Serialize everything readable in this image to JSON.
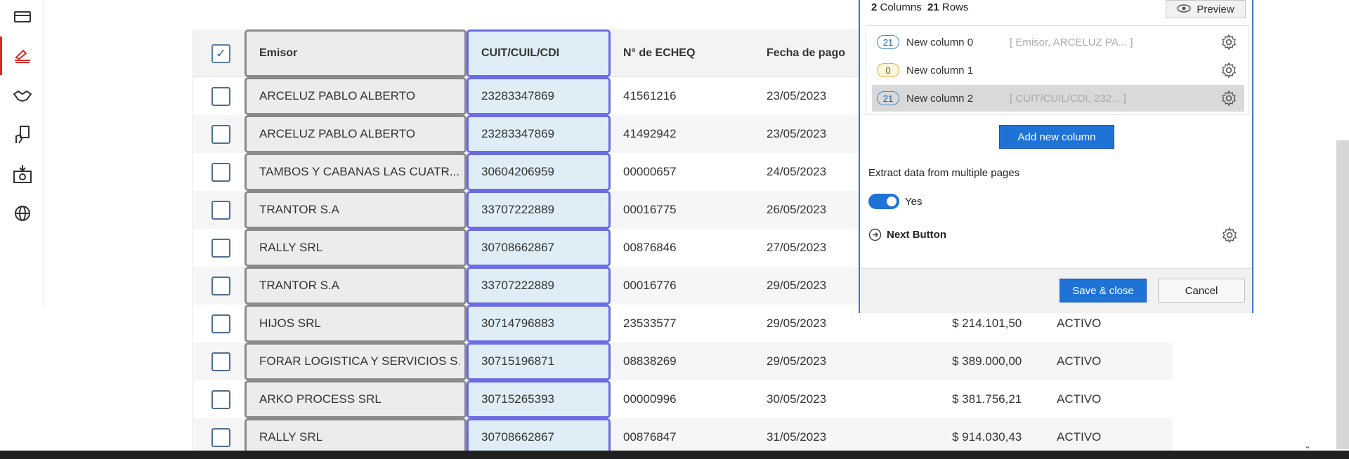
{
  "sidebar": {
    "items": [
      {
        "icon": "card-icon"
      },
      {
        "icon": "signature-icon",
        "active": true
      },
      {
        "icon": "handshake-icon"
      },
      {
        "icon": "hand-document-icon"
      },
      {
        "icon": "money-download-icon"
      },
      {
        "icon": "globe-icon"
      }
    ]
  },
  "table": {
    "headers": [
      "Emisor",
      "CUIT/CUIL/CDI",
      "N° de ECHEQ",
      "Fecha de pago"
    ],
    "rows": [
      {
        "emisor": "ARCELUZ PABLO ALBERTO",
        "cuit": "23283347869",
        "echeq": "41561216",
        "fecha": "23/05/2023",
        "monto": "",
        "estado": ""
      },
      {
        "emisor": "ARCELUZ PABLO ALBERTO",
        "cuit": "23283347869",
        "echeq": "41492942",
        "fecha": "23/05/2023",
        "monto": "",
        "estado": ""
      },
      {
        "emisor": "TAMBOS Y CABANAS LAS CUATR...",
        "cuit": "30604206959",
        "echeq": "00000657",
        "fecha": "24/05/2023",
        "monto": "",
        "estado": ""
      },
      {
        "emisor": "TRANTOR S.A",
        "cuit": "33707222889",
        "echeq": "00016775",
        "fecha": "26/05/2023",
        "monto": "",
        "estado": ""
      },
      {
        "emisor": "RALLY SRL",
        "cuit": "30708662867",
        "echeq": "00876846",
        "fecha": "27/05/2023",
        "monto": "",
        "estado": ""
      },
      {
        "emisor": "TRANTOR S.A",
        "cuit": "33707222889",
        "echeq": "00016776",
        "fecha": "29/05/2023",
        "monto": "",
        "estado": ""
      },
      {
        "emisor": "HIJOS SRL",
        "cuit": "30714796883",
        "echeq": "23533577",
        "fecha": "29/05/2023",
        "monto": "$ 214.101,50",
        "estado": "ACTIVO"
      },
      {
        "emisor": "FORAR LOGISTICA Y SERVICIOS S...",
        "cuit": "30715196871",
        "echeq": "08838269",
        "fecha": "29/05/2023",
        "monto": "$ 389.000,00",
        "estado": "ACTIVO"
      },
      {
        "emisor": "ARKO PROCESS SRL",
        "cuit": "30715265393",
        "echeq": "00000996",
        "fecha": "30/05/2023",
        "monto": "$ 381.756,21",
        "estado": "ACTIVO"
      },
      {
        "emisor": "RALLY SRL",
        "cuit": "30708662867",
        "echeq": "00876847",
        "fecha": "31/05/2023",
        "monto": "$ 914.030,43",
        "estado": "ACTIVO"
      }
    ]
  },
  "dialog": {
    "columns_count": "2",
    "columns_label": "Columns",
    "rows_count": "21",
    "rows_label": "Rows",
    "preview_label": "Preview",
    "columns": [
      {
        "badge": "21",
        "name": "New column 0",
        "preview": "[ Emisor, ARCELUZ PA... ]",
        "highlighted": false
      },
      {
        "badge": "0",
        "name": "New column 1",
        "preview": "",
        "highlighted": false
      },
      {
        "badge": "21",
        "name": "New column 2",
        "preview": "[ CUIT/CUIL/CDI, 232... ]",
        "highlighted": true
      }
    ],
    "add_column_label": "Add new column",
    "extract_label": "Extract data from multiple pages",
    "toggle_label": "Yes",
    "next_button_label": "Next Button",
    "save_label": "Save & close",
    "cancel_label": "Cancel",
    "accent": "#1f73d6"
  }
}
